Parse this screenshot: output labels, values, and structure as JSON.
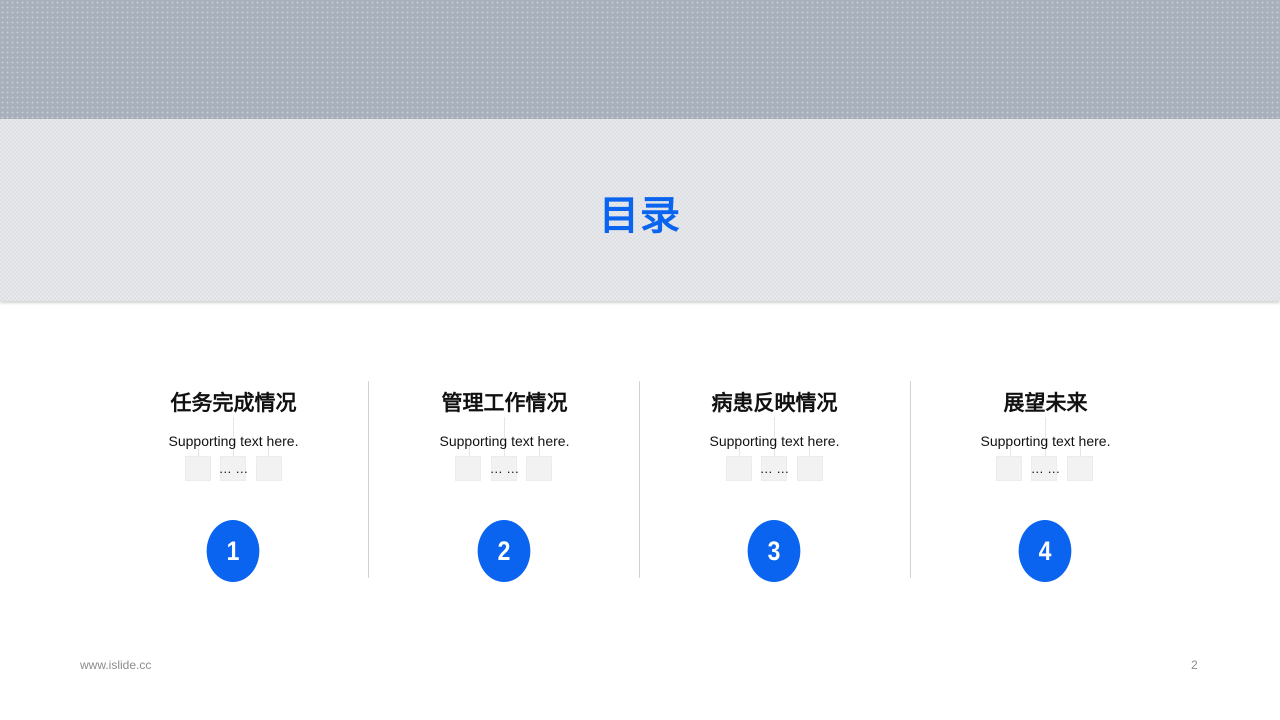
{
  "header": {
    "title": "目录"
  },
  "sections": [
    {
      "number": "1",
      "heading": "任务完成情况",
      "support": "Supporting  text here.",
      "ellipsis": "… …"
    },
    {
      "number": "2",
      "heading": "管理工作情况",
      "support": "Supporting  text here.",
      "ellipsis": "… …"
    },
    {
      "number": "3",
      "heading": "病患反映情况",
      "support": "Supporting  text here.",
      "ellipsis": "… …"
    },
    {
      "number": "4",
      "heading": "展望未来",
      "support": "Supporting  text here.",
      "ellipsis": "… …"
    }
  ],
  "footer": {
    "url": "www.islide.cc",
    "page_number": "2"
  },
  "colors": {
    "accent": "#0a64f0",
    "top_band": "#a8b0bc",
    "title_band": "#dee0e4",
    "divider": "#d2d2d2"
  }
}
